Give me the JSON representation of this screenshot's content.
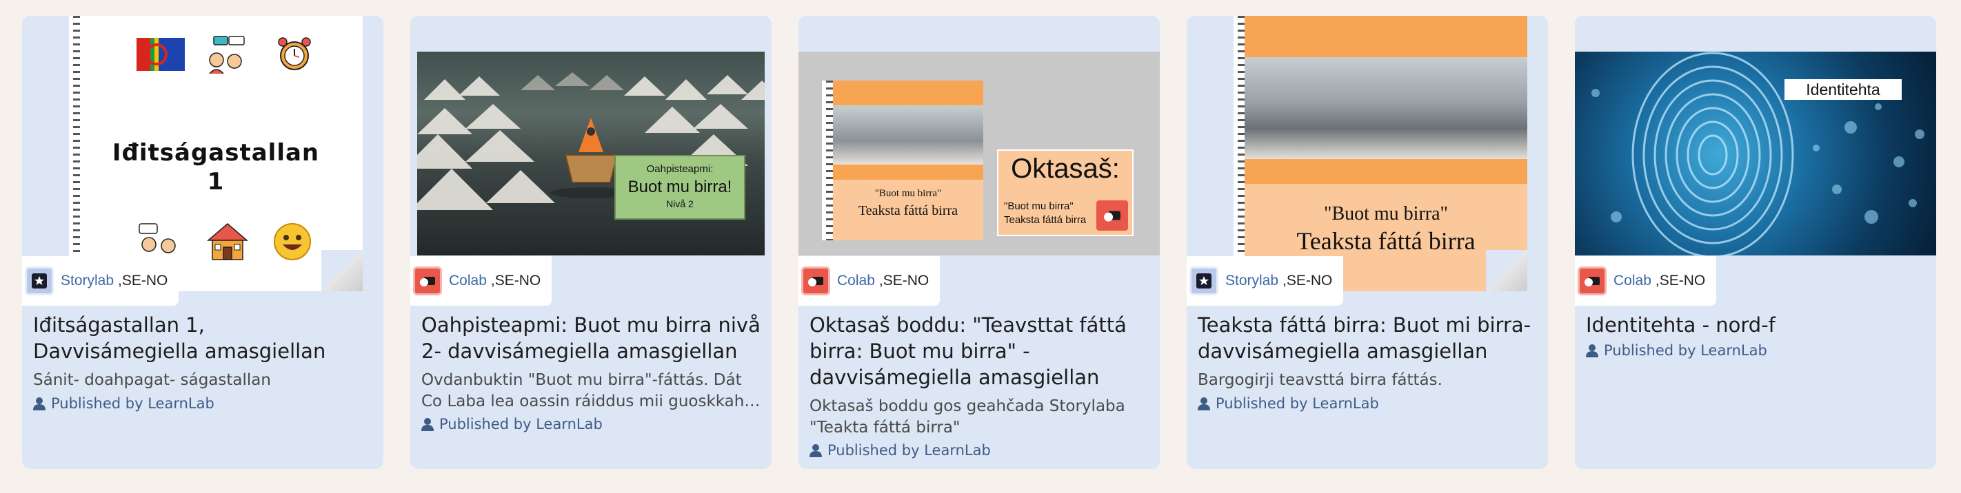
{
  "cards": [
    {
      "tool": "Storylab",
      "lang": ",SE-NO",
      "title": "Iđitságastallan 1, Davvisámegiella amasgiellan",
      "description": "Sánit- doahpagat- ságastallan",
      "publisher": "Published by LearnLab",
      "thumb_text": "Iđitságastallan 1"
    },
    {
      "tool": "Colab",
      "lang": ",SE-NO",
      "title": "Oahpisteapmi: Buot mu birra nivå 2- davvisámegiella amasgiellan",
      "description": "Ovdanbuktin \"Buot mu birra\"-fáttás. Dát Co Laba lea oassin ráiddus mii guoskkaha dat…",
      "publisher": "Published by LearnLab",
      "thumb_small": "Oahpisteapmi:",
      "thumb_big": "Buot mu birra!",
      "thumb_level": "Nivå 2"
    },
    {
      "tool": "Colab",
      "lang": ",SE-NO",
      "title": "Oktasaš boddu: \"Teavsttat fáttá birra: Buot mu birra\" - davvisámegiella amasgiellan",
      "description": "Oktasaš boddu gos geahčada Storylaba \"Teakta fáttá birra\"",
      "publisher": "Published by LearnLab",
      "thumb_book_line1": "\"Buot mu birra\"",
      "thumb_book_line2": "Teaksta fáttá birra",
      "thumb_heading": "Oktasaš:",
      "thumb_sub1": "\"Buot mu birra\"",
      "thumb_sub2": "Teaksta fáttá birra"
    },
    {
      "tool": "Storylab",
      "lang": ",SE-NO",
      "title": "Teaksta fáttá birra: Buot mi birra- davvisámegiella amasgiellan",
      "description": "Bargogirji teavsttá birra fáttás.",
      "publisher": "Published by LearnLab",
      "thumb_line1": "\"Buot mu birra\"",
      "thumb_line2": "Teaksta fáttá birra"
    },
    {
      "tool": "Colab",
      "lang": ",SE-NO",
      "title": "Identitehta - nord-f",
      "description": "",
      "publisher": "Published by LearnLab",
      "thumb_label": "Identitehta"
    }
  ],
  "colors": {
    "page_bg": "#f6f1ec",
    "card_bg": "#dce6f5",
    "link_blue": "#3b67a7",
    "colab_red": "#e9564a"
  },
  "icons": [
    "storylab-icon",
    "colab-icon",
    "user-icon",
    "sami-flag-icon",
    "chat-icon",
    "alarm-clock-icon",
    "house-icon",
    "smiley-icon"
  ]
}
